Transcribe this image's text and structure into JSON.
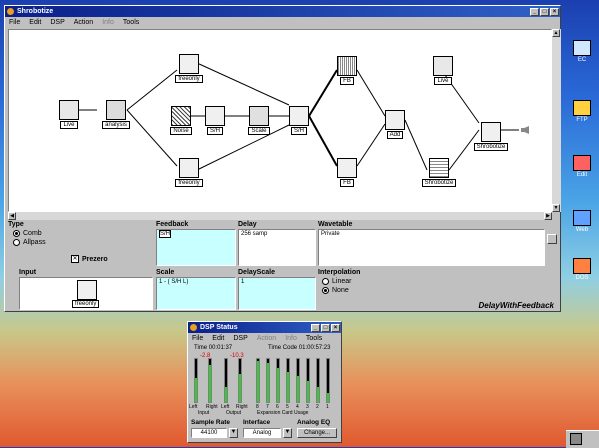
{
  "main_window": {
    "title": "Shrobotize",
    "menu": [
      "File",
      "Edit",
      "DSP",
      "Action",
      "Info",
      "Tools"
    ],
    "menu_disabled": [
      false,
      false,
      false,
      false,
      true,
      false
    ],
    "nodes": {
      "live1": "Live",
      "analysis": "analysis",
      "freeonly_top": "freeonly",
      "noise": "Noise",
      "sh1": "S/H",
      "scale": "Scale",
      "sh2": "S/H",
      "freeonly_bottom": "freeonly",
      "fb_top": "FB",
      "fb_bottom": "FB",
      "add": "Add",
      "live2": "Live",
      "shrobotize_mid": "Shrobotize",
      "shrobotize_out": "Shrobotize"
    },
    "panel": {
      "type_label": "Type",
      "type_options": [
        "Comb",
        "Allpass"
      ],
      "type_selected": "Comb",
      "prezero_label": "Prezero",
      "feedback_label": "Feedback",
      "feedback_value": "S/H",
      "delay_label": "Delay",
      "delay_value": "256 samp",
      "wavetable_label": "Wavetable",
      "wavetable_value": "Private",
      "input_label": "Input",
      "input_node_label": "freeonly",
      "scale_label": "Scale",
      "scale_value": "1 - ( S/H L)",
      "delay_scale_label": "DelayScale",
      "delay_scale_value": "1",
      "interp_label": "Interpolation",
      "interp_options": [
        "Linear",
        "None"
      ],
      "interp_selected": "None",
      "footer_name": "DelayWithFeedback"
    }
  },
  "status_window": {
    "title": "DSP Status",
    "menu": [
      "File",
      "Edit",
      "DSP",
      "Action",
      "Info",
      "Tools"
    ],
    "menu_disabled": [
      false,
      false,
      false,
      true,
      true,
      false
    ],
    "time_label": "Time 00:01:37",
    "timecode_label": "Time Code 01:00:57:23",
    "peak_input": "-2.8",
    "peak_output": "-10.3",
    "input_group_labels": [
      "Left",
      "Right"
    ],
    "input_group_title": "Input",
    "output_group_labels": [
      "Left",
      "Right"
    ],
    "output_group_title": "Output",
    "expansion_numbers": [
      "8",
      "7",
      "6",
      "5",
      "4",
      "3",
      "2",
      "1"
    ],
    "expansion_title": "Expansion Card Usage",
    "input_levels": [
      0.55,
      0.85
    ],
    "output_levels": [
      0.35,
      0.65
    ],
    "expansion_levels": [
      0.95,
      0.9,
      0.8,
      0.7,
      0.6,
      0.5,
      0.35,
      0.2
    ],
    "sample_rate_label": "Sample Rate",
    "sample_rate_value": "44100",
    "interface_label": "Interface",
    "interface_value": "Analog",
    "analog_eq_label": "Analog EQ",
    "change_label": "Change..."
  },
  "desktop_icons": [
    "EC",
    "FTP",
    "Edit",
    "Web",
    "DOS"
  ]
}
